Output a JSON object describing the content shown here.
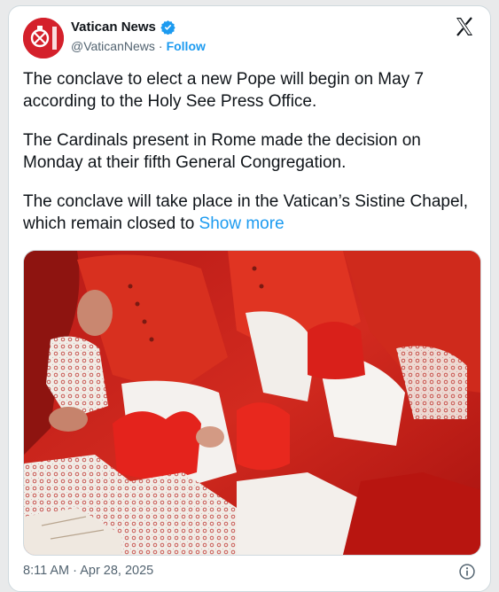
{
  "author": {
    "display_name": "Vatican News",
    "handle": "@VaticanNews",
    "separator": "·",
    "follow_label": "Follow",
    "avatar_icon": "vatican-news-logo-icon",
    "verified_icon": "verified-badge-icon",
    "brand_color": "#d4202b"
  },
  "tweet": {
    "paragraphs": [
      "The conclave to elect a new Pope will begin on May 7 according to the Holy See Press Office.",
      "The Cardinals present in Rome made the decision on Monday at their fifth General Congregation."
    ],
    "truncated_paragraph": "The conclave will take place in the Vatican’s Sistine Chapel, which remain closed to",
    "show_more_label": "Show more",
    "timestamp": "8:11 AM · Apr 28, 2025"
  },
  "colors": {
    "text_primary": "#0f1419",
    "text_secondary": "#536471",
    "link": "#1d9bf0"
  },
  "icons": {
    "platform": "x-logo-icon",
    "info": "info-icon"
  }
}
